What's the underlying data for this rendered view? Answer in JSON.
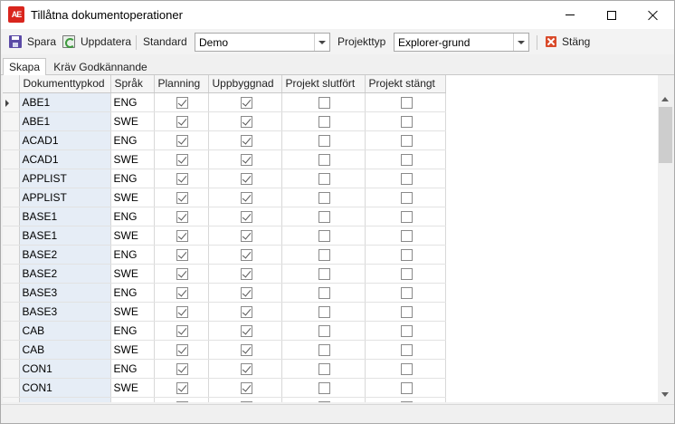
{
  "window": {
    "title": "Tillåtna dokumentoperationer",
    "icon_text": "AE"
  },
  "toolbar": {
    "save_label": "Spara",
    "refresh_label": "Uppdatera",
    "standard_label": "Standard",
    "standard_value": "Demo",
    "projecttype_label": "Projekttyp",
    "projecttype_value": "Explorer-grund",
    "close_label": "Stäng"
  },
  "tabs": [
    {
      "label": "Skapa",
      "active": true
    },
    {
      "label": "Kräv Godkännande",
      "active": false
    }
  ],
  "grid": {
    "columns": [
      "Dokumenttypkod",
      "Språk",
      "Planning",
      "Uppbyggnad",
      "Projekt slutfört",
      "Projekt stängt"
    ],
    "rows": [
      {
        "code": "ABE1",
        "lang": "ENG",
        "planning": true,
        "uppbyggnad": true,
        "slutfort": false,
        "stangt": false
      },
      {
        "code": "ABE1",
        "lang": "SWE",
        "planning": true,
        "uppbyggnad": true,
        "slutfort": false,
        "stangt": false
      },
      {
        "code": "ACAD1",
        "lang": "ENG",
        "planning": true,
        "uppbyggnad": true,
        "slutfort": false,
        "stangt": false
      },
      {
        "code": "ACAD1",
        "lang": "SWE",
        "planning": true,
        "uppbyggnad": true,
        "slutfort": false,
        "stangt": false
      },
      {
        "code": "APPLIST",
        "lang": "ENG",
        "planning": true,
        "uppbyggnad": true,
        "slutfort": false,
        "stangt": false
      },
      {
        "code": "APPLIST",
        "lang": "SWE",
        "planning": true,
        "uppbyggnad": true,
        "slutfort": false,
        "stangt": false
      },
      {
        "code": "BASE1",
        "lang": "ENG",
        "planning": true,
        "uppbyggnad": true,
        "slutfort": false,
        "stangt": false
      },
      {
        "code": "BASE1",
        "lang": "SWE",
        "planning": true,
        "uppbyggnad": true,
        "slutfort": false,
        "stangt": false
      },
      {
        "code": "BASE2",
        "lang": "ENG",
        "planning": true,
        "uppbyggnad": true,
        "slutfort": false,
        "stangt": false
      },
      {
        "code": "BASE2",
        "lang": "SWE",
        "planning": true,
        "uppbyggnad": true,
        "slutfort": false,
        "stangt": false
      },
      {
        "code": "BASE3",
        "lang": "ENG",
        "planning": true,
        "uppbyggnad": true,
        "slutfort": false,
        "stangt": false
      },
      {
        "code": "BASE3",
        "lang": "SWE",
        "planning": true,
        "uppbyggnad": true,
        "slutfort": false,
        "stangt": false
      },
      {
        "code": "CAB",
        "lang": "ENG",
        "planning": true,
        "uppbyggnad": true,
        "slutfort": false,
        "stangt": false
      },
      {
        "code": "CAB",
        "lang": "SWE",
        "planning": true,
        "uppbyggnad": true,
        "slutfort": false,
        "stangt": false
      },
      {
        "code": "CON1",
        "lang": "ENG",
        "planning": true,
        "uppbyggnad": true,
        "slutfort": false,
        "stangt": false
      },
      {
        "code": "CON1",
        "lang": "SWE",
        "planning": true,
        "uppbyggnad": true,
        "slutfort": false,
        "stangt": false
      },
      {
        "code": "",
        "lang": "",
        "planning": true,
        "uppbyggnad": true,
        "slutfort": false,
        "stangt": false
      }
    ]
  },
  "colors": {
    "code_column_bg": "#e6edf6",
    "app_icon": "#d9251d",
    "close_icon": "#d94a2a"
  },
  "icons": {
    "save": "save-icon",
    "refresh": "refresh-icon",
    "close": "close-icon",
    "row_indicator": "row-indicator-icon"
  }
}
